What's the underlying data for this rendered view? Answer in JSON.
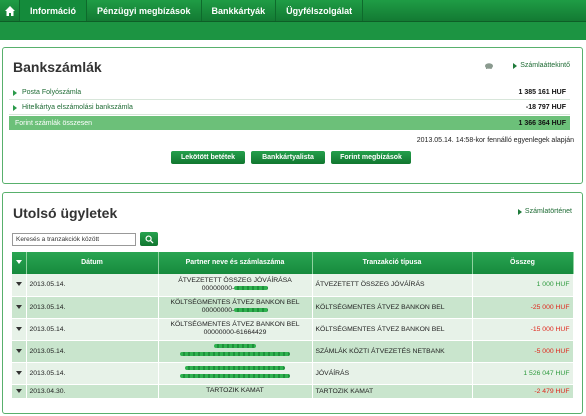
{
  "nav": {
    "items": [
      {
        "label": "Információ"
      },
      {
        "label": "Pénzügyi megbízások"
      },
      {
        "label": "Bankkártyák"
      },
      {
        "label": "Ügyfélszolgálat"
      }
    ]
  },
  "accounts": {
    "title": "Bankszámlák",
    "statement_link": "Számlaáttekintő",
    "rows": [
      {
        "name": "Posta Folyószámla",
        "amount": "1 385 161 HUF"
      },
      {
        "name": "Hitelkártya elszámolási bankszámla",
        "amount": "-18 797 HUF"
      }
    ],
    "total": {
      "name": "Forint számlák összesen",
      "amount": "1 366 364 HUF"
    },
    "note": "2013.05.14. 14:58-kor fennálló egyenlegek alapján",
    "buttons": {
      "deposits": "Lekötött betétek",
      "cards": "Bankkártyalista",
      "transfers": "Forint megbízások"
    }
  },
  "transactions": {
    "title": "Utolsó ügyletek",
    "history_link": "Számlatörténet",
    "search": {
      "value": "Keresés a tranzakciók között"
    },
    "headers": {
      "date": "Dátum",
      "partner": "Partner neve és számlaszáma",
      "type": "Tranzakció típusa",
      "amount": "Összeg"
    },
    "rows": [
      {
        "date": "2013.05.14.",
        "partner1": "ÁTVEZETETT ÖSSZEG JÓVÁÍRÁSA",
        "partner2": "00000000-",
        "type": "ÁTVEZETETT ÖSSZEG JÓVÁÍRÁS",
        "amount": "1 000 HUF",
        "sign": "pos"
      },
      {
        "date": "2013.05.14.",
        "partner1": "KÖLTSÉGMENTES ÁTVEZ BANKON BEL",
        "partner2": "00000000-",
        "type": "KÖLTSÉGMENTES ÁTVEZ BANKON BEL",
        "amount": "-25 000 HUF",
        "sign": "neg"
      },
      {
        "date": "2013.05.14.",
        "partner1": "KÖLTSÉGMENTES ÁTVEZ BANKON BEL",
        "partner2": "00000000-61664429",
        "type": "KÖLTSÉGMENTES ÁTVEZ BANKON BEL",
        "amount": "-15 000 HUF",
        "sign": "neg"
      },
      {
        "date": "2013.05.14.",
        "partner1": "",
        "partner2": "",
        "type": "SZÁMLÁK KÖZTI ÁTVEZETÉS NETBANK",
        "amount": "-5 000 HUF",
        "sign": "neg"
      },
      {
        "date": "2013.05.14.",
        "partner1": "",
        "partner2": "",
        "type": "JÓVÁÍRÁS",
        "amount": "1 526 047 HUF",
        "sign": "pos"
      },
      {
        "date": "2013.04.30.",
        "partner1": "TARTOZIK KAMAT",
        "partner2": "",
        "type": "TARTOZIK KAMAT",
        "amount": "-2 479 HUF",
        "sign": "neg"
      }
    ]
  },
  "colors": {
    "brand": "#1c9442",
    "negative": "#e0261b",
    "positive": "#2e9a3e"
  }
}
